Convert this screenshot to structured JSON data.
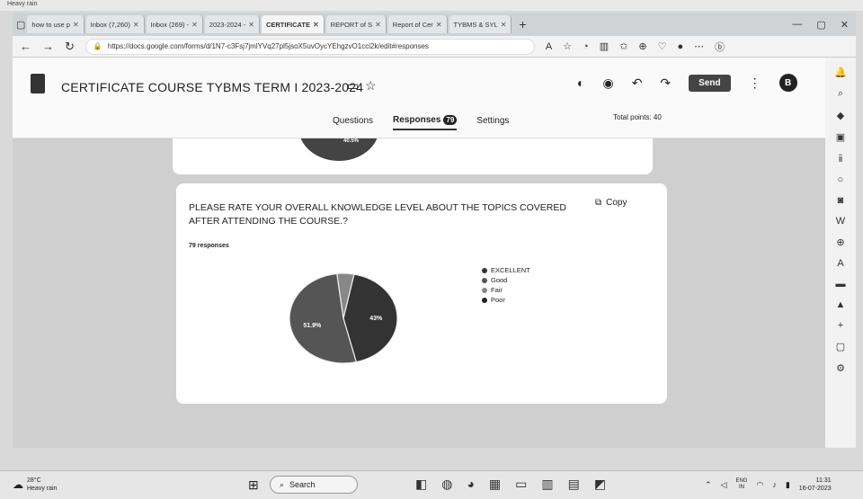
{
  "topstrip": {
    "weather_text": "Heavy rain"
  },
  "browser": {
    "tabs": [
      {
        "label": "how to use p",
        "active": false
      },
      {
        "label": "Inbox (7,260)",
        "active": false
      },
      {
        "label": "Inbox (269) -",
        "active": false
      },
      {
        "label": "2023-2024 -",
        "active": false
      },
      {
        "label": "CERTIFICATE",
        "active": true
      },
      {
        "label": "REPORT of S",
        "active": false
      },
      {
        "label": "Report of Cer",
        "active": false
      },
      {
        "label": "TYBMS & SYL",
        "active": false
      }
    ],
    "new_tab": "+",
    "url": "https://docs.google.com/forms/d/1N7-c3Fsj7jmlYVq27pl5jsoX5uvOycYEhgzvO1cci2k/edit#responses"
  },
  "form": {
    "title": "CERTIFICATE COURSE TYBMS TERM I 2023-2024",
    "send_label": "Send",
    "avatar_letter": "B",
    "tabs": {
      "questions": "Questions",
      "responses": "Responses",
      "settings": "Settings"
    },
    "responses_badge": "79",
    "total_points": "Total points: 40"
  },
  "prev_card": {
    "slice_label": "40.5%"
  },
  "question": {
    "title": "PLEASE RATE YOUR OVERALL KNOWLEDGE LEVEL ABOUT THE TOPICS COVERED AFTER ATTENDING THE COURSE.?",
    "copy_label": "Copy",
    "responses": "79 responses"
  },
  "chart_data": {
    "type": "pie",
    "categories": [
      "EXCELLENT",
      "Good",
      "Fair",
      "Poor"
    ],
    "values": [
      43,
      51.9,
      5.1,
      0
    ],
    "data_labels": [
      "43%",
      "51.9%"
    ],
    "legend_placement": "right",
    "colors": [
      "#333333",
      "#555555",
      "#888888",
      "#222222"
    ]
  },
  "taskbar": {
    "temp": "28°C",
    "weather": "Heavy rain",
    "search": "Search",
    "lang1": "ENG",
    "lang2": "IN",
    "time": "11:31",
    "date": "16-07-2023"
  }
}
